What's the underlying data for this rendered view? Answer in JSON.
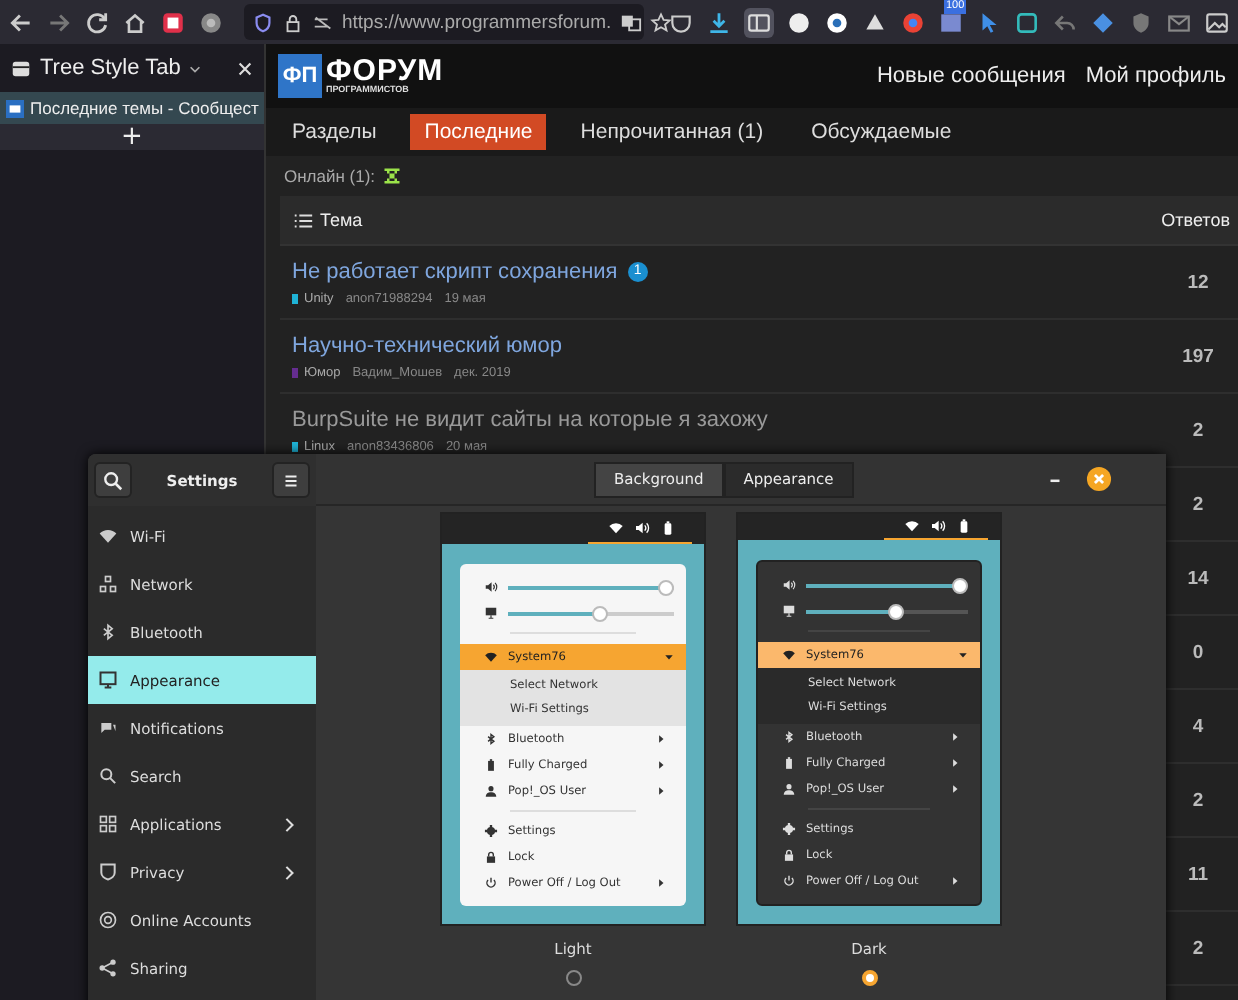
{
  "toolbar": {
    "url": "https://www.programmersforum.",
    "badge": "100"
  },
  "tab_sidebar": {
    "title": "Tree Style Tab",
    "tabs": [
      {
        "title": "Последние темы - Сообщест",
        "selected": true
      }
    ],
    "new_tab": "+"
  },
  "forum": {
    "logo": {
      "mark": "ФП",
      "name": "ФОРУМ",
      "tagline": "ПРОГРАММИСТОВ"
    },
    "header_links": [
      "Новые сообщения",
      "Мой профиль"
    ],
    "nav": [
      {
        "label": "Разделы",
        "selected": false
      },
      {
        "label": "Последние",
        "selected": true
      },
      {
        "label": "Непрочитанная (1)",
        "selected": false
      },
      {
        "label": "Обсуждаемые",
        "selected": false
      }
    ],
    "online": "Онлайн (1):",
    "table": {
      "columns": [
        "Тема",
        "Ответов"
      ],
      "rows": [
        {
          "title": "Не работает скрипт сохранения",
          "visited": false,
          "badge": "1",
          "category": "Unity",
          "color": "#1fb3d6",
          "author": "anon71988294",
          "date": "19 мая",
          "replies": "12"
        },
        {
          "title": "Научно-технический юмор",
          "visited": false,
          "category": "Юмор",
          "color": "#652d90",
          "author": "Вадим_Мошев",
          "date": "дек. 2019",
          "replies": "197"
        },
        {
          "title": "BurpSuite не видит сайты на которые я захожу",
          "visited": true,
          "category": "Linux",
          "color": "#1fb3d6",
          "author": "anon83436806",
          "date": "20 мая",
          "replies": "2"
        },
        {
          "replies": "2"
        },
        {
          "replies": "14"
        },
        {
          "replies": "0"
        },
        {
          "replies": "4"
        },
        {
          "replies": "2"
        },
        {
          "replies": "11"
        },
        {
          "replies": "2"
        }
      ]
    }
  },
  "settings": {
    "title": "Settings",
    "tabs": [
      {
        "label": "Background",
        "selected": false
      },
      {
        "label": "Appearance",
        "selected": true
      }
    ],
    "nav": [
      {
        "label": "Wi-Fi",
        "selected": false,
        "submenu": false
      },
      {
        "label": "Network",
        "selected": false,
        "submenu": false
      },
      {
        "label": "Bluetooth",
        "selected": false,
        "submenu": false
      },
      {
        "label": "Appearance",
        "selected": true,
        "submenu": false
      },
      {
        "label": "Notifications",
        "selected": false,
        "submenu": false
      },
      {
        "label": "Search",
        "selected": false,
        "submenu": false
      },
      {
        "label": "Applications",
        "selected": false,
        "submenu": true
      },
      {
        "label": "Privacy",
        "selected": false,
        "submenu": true
      },
      {
        "label": "Online Accounts",
        "selected": false,
        "submenu": false
      },
      {
        "label": "Sharing",
        "selected": false,
        "submenu": false
      }
    ],
    "themes": [
      {
        "label": "Light",
        "kind": "light",
        "selected": false,
        "volume": {
          "level": 0.95
        },
        "brightness": {
          "level": 0.55
        },
        "network": "System76",
        "network_items": [
          "Select Network",
          "Wi-Fi Settings"
        ],
        "items": [
          {
            "label": "Bluetooth",
            "submenu": true
          },
          {
            "label": "Fully Charged",
            "submenu": true
          },
          {
            "label": "Pop!_OS User",
            "submenu": true
          },
          {
            "label": "Settings",
            "submenu": false
          },
          {
            "label": "Lock",
            "submenu": false
          },
          {
            "label": "Power Off / Log Out",
            "submenu": true
          }
        ]
      },
      {
        "label": "Dark",
        "kind": "dark",
        "selected": true,
        "volume": {
          "level": 0.95
        },
        "brightness": {
          "level": 0.55
        },
        "network": "System76",
        "network_items": [
          "Select Network",
          "Wi-Fi Settings"
        ],
        "items": [
          {
            "label": "Bluetooth",
            "submenu": true
          },
          {
            "label": "Fully Charged",
            "submenu": true
          },
          {
            "label": "Pop!_OS User",
            "submenu": true
          },
          {
            "label": "Settings",
            "submenu": false
          },
          {
            "label": "Lock",
            "submenu": false
          },
          {
            "label": "Power Off / Log Out",
            "submenu": true
          }
        ]
      }
    ]
  }
}
